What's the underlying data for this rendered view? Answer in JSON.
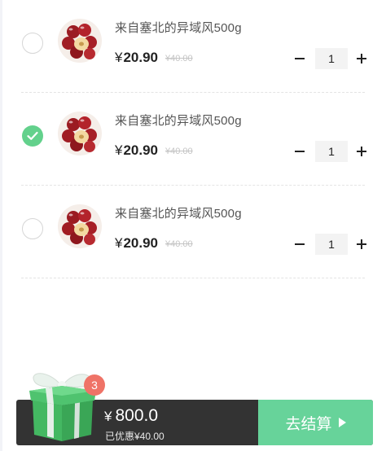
{
  "cart": {
    "items": [
      {
        "title": "来自塞北的异域风500g",
        "currency": "¥",
        "price": "20.90",
        "original_price": "¥40.00",
        "quantity": "1",
        "checked": false
      },
      {
        "title": "来自塞北的异域风500g",
        "currency": "¥",
        "price": "20.90",
        "original_price": "¥40.00",
        "quantity": "1",
        "checked": true
      },
      {
        "title": "来自塞北的异域风500g",
        "currency": "¥",
        "price": "20.90",
        "original_price": "¥40.00",
        "quantity": "1",
        "checked": false
      }
    ],
    "stepper": {
      "minus": "−",
      "plus": "+"
    }
  },
  "summary": {
    "currency": "¥",
    "total": "800.0",
    "discount_text": "已优惠¥40.00",
    "badge_count": "3",
    "checkout_label": "去结算"
  },
  "icons": {
    "check": "check-icon",
    "gift": "gift-box-icon",
    "play": "triangle-right-icon"
  },
  "colors": {
    "accent_green": "#67d39a",
    "check_green": "#63d18c",
    "badge_red": "#ef7367",
    "bar_dark": "#333333"
  }
}
